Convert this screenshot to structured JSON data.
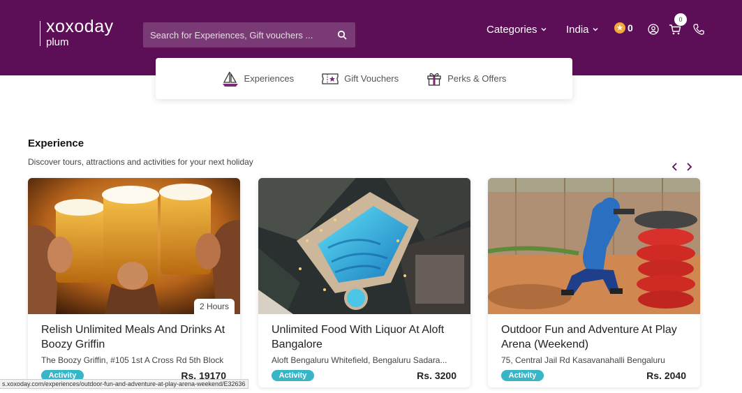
{
  "brand": {
    "name": "xoxoday",
    "sub": "plum"
  },
  "search": {
    "placeholder": "Search for Experiences, Gift vouchers ..."
  },
  "nav": {
    "categories": "Categories",
    "country": "India",
    "coins": "0",
    "cart_count": "0"
  },
  "subnav": [
    {
      "label": "Experiences",
      "icon": "sailboat-icon"
    },
    {
      "label": "Gift Vouchers",
      "icon": "voucher-icon"
    },
    {
      "label": "Perks & Offers",
      "icon": "gift-icon"
    }
  ],
  "section": {
    "title": "Experience",
    "subtitle": "Discover tours, attractions and activities for your next holiday"
  },
  "cards": [
    {
      "title": "Relish Unlimited Meals And Drinks At Boozy Griffin",
      "address": "The Boozy Griffin, #105 1st A Cross Rd 5th Block",
      "badge": "Activity",
      "price": "Rs. 19170",
      "duration": "2 Hours"
    },
    {
      "title": "Unlimited Food With Liquor At Aloft Bangalore",
      "address": "Aloft Bengaluru Whitefield, Bengaluru Sadara...",
      "badge": "Activity",
      "price": "Rs. 3200",
      "duration": ""
    },
    {
      "title": "Outdoor Fun and Adventure At Play Arena (Weekend)",
      "address": "75, Central Jail Rd Kasavanahalli Bengaluru",
      "badge": "Activity",
      "price": "Rs. 2040",
      "duration": ""
    }
  ],
  "status_url": "s.xoxoday.com/experiences/outdoor-fun-and-adventure-at-play-arena-weekend/E32636",
  "colors": {
    "header": "#5c0f57",
    "badge": "#38b5c6",
    "coin": "#f4a83a"
  }
}
